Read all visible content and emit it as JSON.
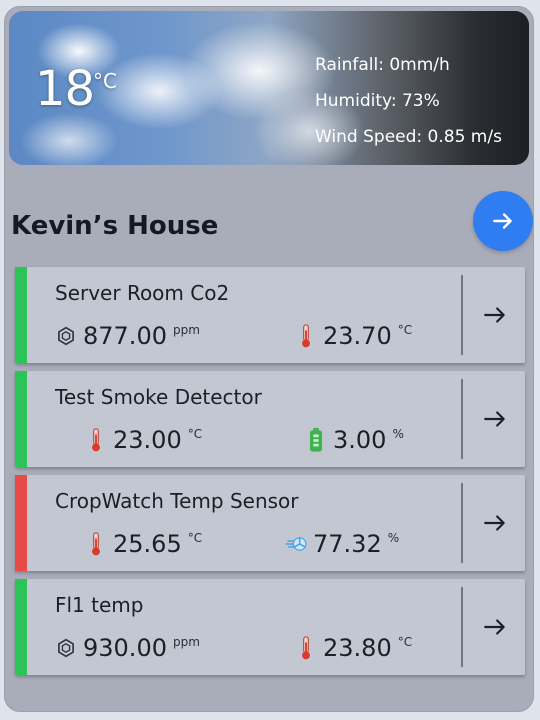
{
  "weather": {
    "temperature": "18",
    "temperature_unit": "°C",
    "rainfall": "Rainfall: 0mm/h",
    "humidity": "Humidity: 73%",
    "wind_speed": "Wind Speed: 0.85 m/s"
  },
  "house": {
    "title": "Kevin’s House"
  },
  "colors": {
    "ok": "#2ec25a",
    "alert": "#e84a4a",
    "accent": "#2f7df0"
  },
  "devices": [
    {
      "name": "Server Room Co2",
      "status": "ok",
      "reading1": {
        "icon": "co2-icon",
        "value": "877.00",
        "unit": "ppm"
      },
      "reading2": {
        "icon": "thermometer-icon",
        "value": "23.70",
        "unit": "°C"
      }
    },
    {
      "name": "Test Smoke Detector",
      "status": "ok",
      "reading1": {
        "icon": "thermometer-icon",
        "value": "23.00",
        "unit": "°C"
      },
      "reading2": {
        "icon": "battery-icon",
        "value": "3.00",
        "unit": "%"
      }
    },
    {
      "name": "CropWatch Temp Sensor",
      "status": "alert",
      "reading1": {
        "icon": "thermometer-icon",
        "value": "25.65",
        "unit": "°C"
      },
      "reading2": {
        "icon": "humidity-icon",
        "value": "77.32",
        "unit": "%"
      }
    },
    {
      "name": "Fl1 temp",
      "status": "ok",
      "reading1": {
        "icon": "co2-icon",
        "value": "930.00",
        "unit": "ppm"
      },
      "reading2": {
        "icon": "thermometer-icon",
        "value": "23.80",
        "unit": "°C"
      }
    }
  ]
}
